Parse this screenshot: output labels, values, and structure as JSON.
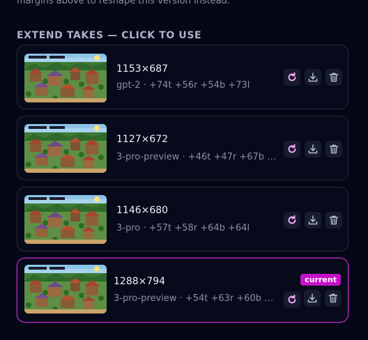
{
  "top_note": "margins above to reshape this version instead.",
  "section_title": "EXTEND TAKES — CLICK TO USE",
  "icons": {
    "redo": "redo-icon",
    "download": "download-icon",
    "delete": "trash-icon"
  },
  "colors": {
    "accent": "#c411c8",
    "redo_icon": "#f0a6f5",
    "border": "#262b3d"
  },
  "takes": [
    {
      "dims": "1153×687",
      "meta": "gpt-2 · +74t +56r +54b +73l",
      "current": false
    },
    {
      "dims": "1127×672",
      "meta": "3-pro-preview · +46t +47r +67b +…",
      "current": false
    },
    {
      "dims": "1146×680",
      "meta": "3-pro · +57t +58r +64b +64l",
      "current": false
    },
    {
      "dims": "1288×794",
      "meta": "3-pro-preview · +54t +63r +60b +…",
      "current": true,
      "badge": "current"
    }
  ]
}
